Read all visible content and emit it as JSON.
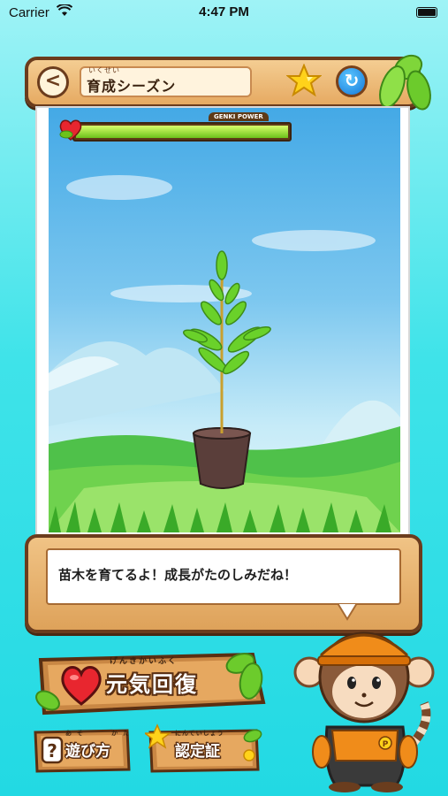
{
  "status_bar": {
    "carrier": "Carrier",
    "time": "4:47 PM"
  },
  "header": {
    "title_ruby": "いくせい",
    "title": "育成シーズン",
    "icons": [
      "back-arrow-icon",
      "star-icon",
      "refresh-icon",
      "leaf-icon"
    ]
  },
  "genki": {
    "label": "GENKI POWER",
    "level": 1.0
  },
  "message": {
    "text": "苗木を育てるよ！成長がたのしみだね！"
  },
  "buttons": {
    "recover_ruby": "げんきかいふく",
    "recover": "元気回復",
    "howto_ruby": "あそ　　かた",
    "howto": "遊び方",
    "cert_ruby": "にんていしょう",
    "cert": "認定証"
  },
  "colors": {
    "wood_light": "#f4cd92",
    "wood_dark": "#6b3c1d",
    "sky": "#44a9e6",
    "grass": "#5cc83a",
    "background": "#3fe3e9"
  }
}
